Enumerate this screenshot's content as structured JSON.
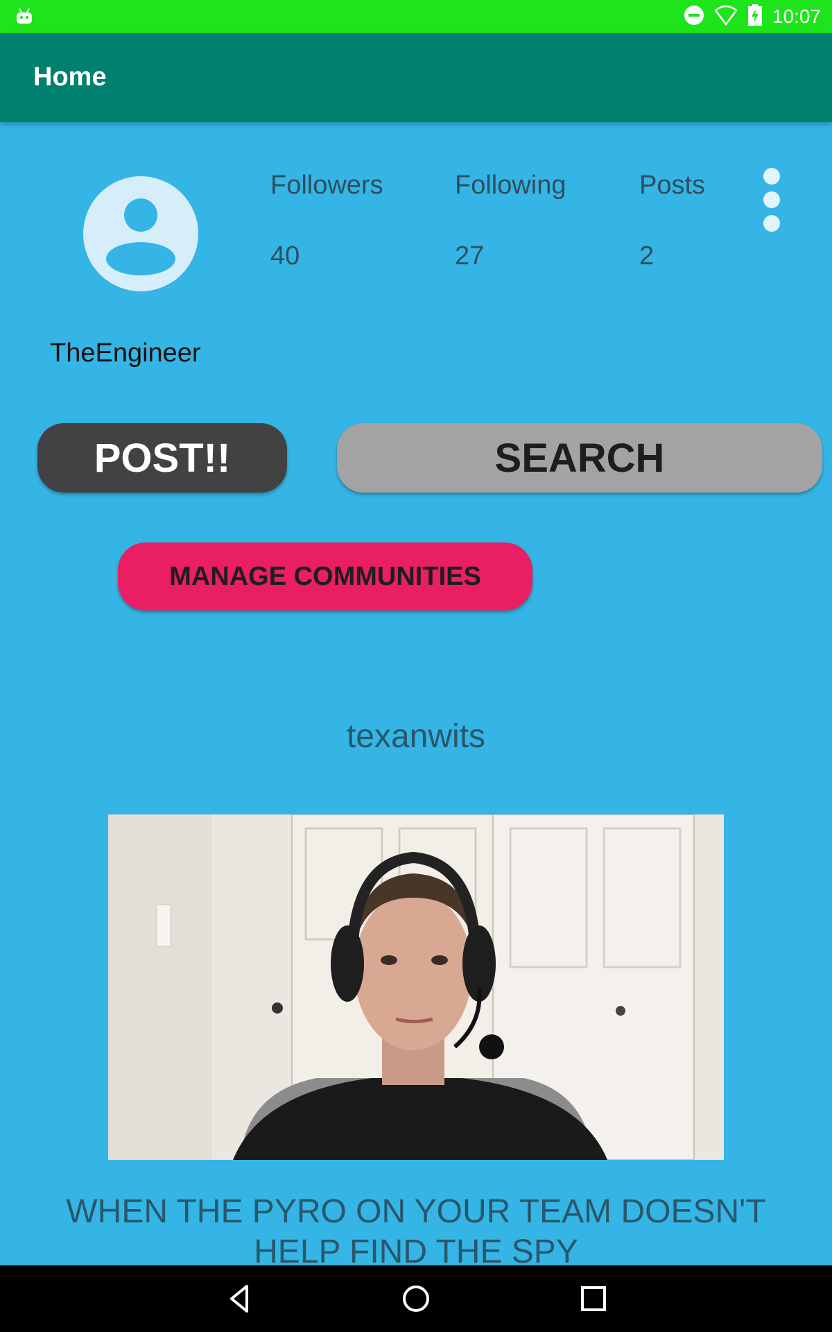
{
  "status_bar": {
    "time": "10:07",
    "icons": [
      "android-icon",
      "do-not-disturb-icon",
      "wifi-icon",
      "battery-charging-icon"
    ],
    "color": "#1ee51b"
  },
  "app_bar": {
    "title": "Home",
    "color": "#00806e"
  },
  "profile": {
    "username": "TheEngineer",
    "stats": [
      {
        "label": "Followers",
        "value": "40"
      },
      {
        "label": "Following",
        "value": "27"
      },
      {
        "label": "Posts",
        "value": "2"
      }
    ]
  },
  "actions": {
    "post_label": "POST!!",
    "search_label": "SEARCH",
    "manage_label": "MANAGE COMMUNITIES"
  },
  "feed": {
    "post": {
      "author": "texanwits",
      "caption": "WHEN THE PYRO ON YOUR TEAM DOESN'T HELP FIND THE SPY"
    }
  },
  "nav_bar": {
    "icons": [
      "back-icon",
      "home-icon",
      "recents-icon"
    ]
  },
  "colors": {
    "background": "#35b5e5",
    "post_button": "#424242",
    "search_button": "#a3a3a3",
    "manage_button": "#e91e63"
  }
}
